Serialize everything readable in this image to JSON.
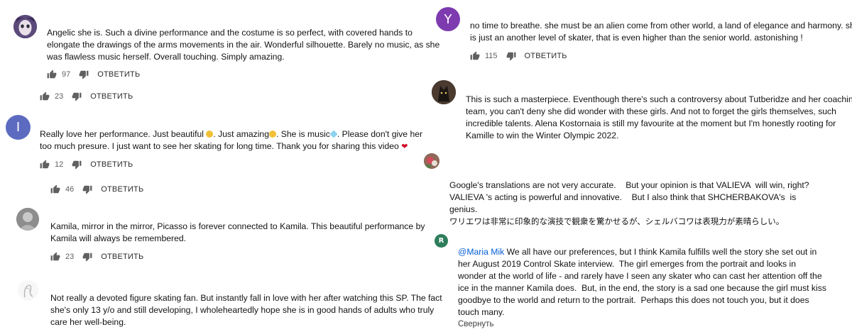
{
  "colors": {
    "reply_text": "#2b2b2b",
    "count_text": "#606060",
    "link": "#065fd4",
    "avatar_I": "#5c6bc0",
    "avatar_Y": "#7e3bb0",
    "avatar_R": "#2e7d5b"
  },
  "left": [
    {
      "avatar": {
        "type": "image",
        "icon": "doll-face-avatar"
      },
      "lines": [
        "Angelic she is. Such a divine performance and the costume is so perfect, with covered hands to",
        "elongate the drawings of the arms movements in the air. Wonderful silhouette. Barely no music, as she",
        "was flawless music herself. Overall touching. Simply amazing."
      ],
      "likes": "97",
      "reply": "ОТВЕТИТЬ"
    },
    {
      "avatar": null,
      "lines": [],
      "likes": "23",
      "reply": "ОТВЕТИТЬ"
    },
    {
      "avatar": {
        "type": "letter",
        "letter": "I"
      },
      "lines": [
        "Really love her performance. Just beautiful",
        ". Just amazing",
        ". She is music",
        ". Please don't give her",
        "too much presure. I just want to see her skating for long time. Thank you for sharing this video"
      ],
      "likes": "12",
      "reply": "ОТВЕТИТЬ"
    },
    {
      "avatar": null,
      "lines": [],
      "likes": "46",
      "reply": "ОТВЕТИТЬ"
    },
    {
      "avatar": {
        "type": "image",
        "icon": "gray-photo-avatar"
      },
      "lines": [
        "Kamila, mirror in the mirror, Picasso is forever connected to Kamila. This beautiful performance by",
        "Kamila will always be remembered."
      ],
      "likes": "23",
      "reply": "ОТВЕТИТЬ"
    },
    {
      "avatar": {
        "type": "image",
        "icon": "sketch-avatar"
      },
      "lines": [
        "Not really a devoted figure skating fan. But instantly fall in love with her after watching this SP. The fact",
        "she's only 13 y/o and still developing, I wholeheartedly hope she is in good hands of adults who truly",
        "care her well-being."
      ]
    }
  ],
  "right": [
    {
      "avatar": {
        "type": "letter",
        "letter": "Y"
      },
      "lines": [
        "no time to breathe. she must be an alien come from other world, a land of elegance and harmony. she",
        "is just an another level of skater, that is even higher than the senior world. astonishing !"
      ],
      "likes": "115",
      "reply": "ОТВЕТИТЬ"
    },
    {
      "avatar": {
        "type": "image",
        "icon": "dark-photo-avatar"
      },
      "lines": [
        "This is such a masterpiece. Eventhough there's such a controversy about Tutberidze and her coaching",
        "team, you can't deny she did wonder with these girls. And not to forget the girls themselves, such",
        "incredible talents. Alena Kostornaia is still my favourite at the moment but I'm honestly rooting for",
        "Kamille to win the Winter Olympic 2022."
      ]
    },
    {
      "avatar": {
        "type": "image",
        "icon": "flower-photo-avatar"
      },
      "lines": [
        "Google's translations are not very accurate.    But your opinion is that VALIEVA  will win, right?",
        "VALIEVA 's acting is powerful and innovative.    But I also think that SHCHERBAKOVA's  is",
        "genius.",
        "ワリエワは非常に印象的な演技で観衆を驚かせるが、シェルバコワは表現力が素晴らしい。"
      ]
    },
    {
      "avatar": {
        "type": "letter",
        "letter": "R"
      },
      "mention": "@Maria Mik",
      "lines": [
        " We all have our preferences, but I think Kamila fulfills well the story she set out in",
        "her August 2019 Control Skate interview.  The girl emerges from the portrait and looks in",
        "wonder at the world of life - and rarely have I seen any skater who can cast her attention off the",
        "ice in the manner Kamila does.  But, in the end, the story is a sad one because the girl must kiss",
        "goodbye to the world and return to the portrait.  Perhaps this does not touch you, but it does",
        "touch many."
      ],
      "collapse": "Свернуть"
    }
  ]
}
